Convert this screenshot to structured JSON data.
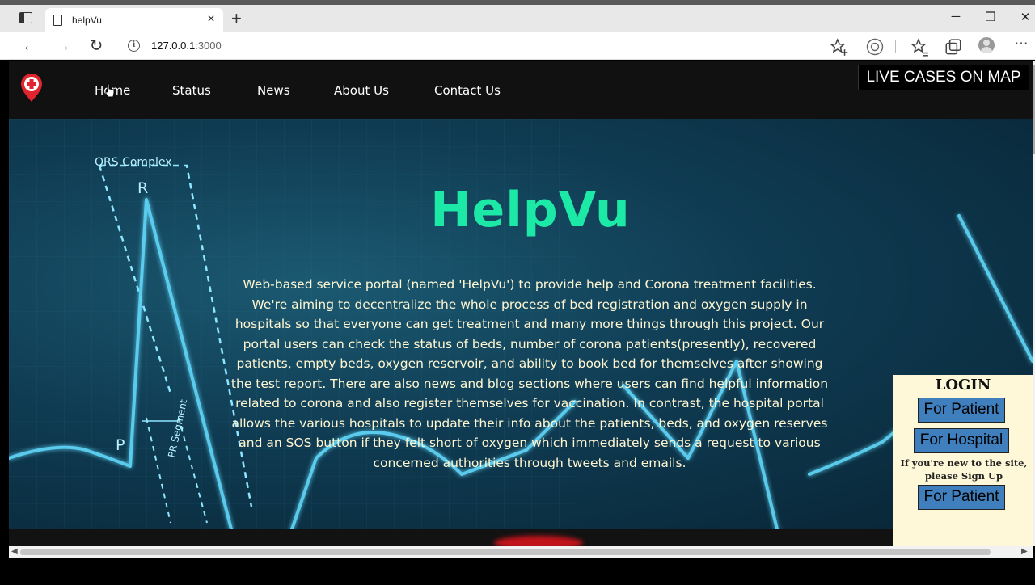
{
  "browser": {
    "tab_title": "helpVu",
    "url_host": "127.0.0.1",
    "url_port": ":3000",
    "new_tab_glyph": "+",
    "close_tab_glyph": "×",
    "minimize_glyph": "─",
    "restore_glyph": "❐",
    "close_window_glyph": "✕",
    "back_glyph": "←",
    "forward_glyph": "→",
    "reload_glyph": "↻",
    "more_glyph": "⋯"
  },
  "site": {
    "nav": [
      {
        "label": "Home"
      },
      {
        "label": "Status"
      },
      {
        "label": "News"
      },
      {
        "label": "About Us"
      },
      {
        "label": "Contact Us"
      }
    ],
    "live_button": "LIVE CASES ON MAP",
    "hero_title": "HelpVu",
    "hero_description": "Web-based service portal (named 'HelpVu') to provide help and Corona treatment facilities. We're aiming to decentralize the whole process of bed registration and oxygen supply in hospitals so that everyone can get treatment and many more things through this project. Our portal users can check the status of beds, number of corona patients(presently), recovered patients, empty beds, oxygen reservoir, and ability to book bed for themselves after showing the test report. There are also news and blog sections where users can find helpful information related to corona and also register themselves for vaccination. In contrast, the hospital portal allows the various hospitals to update their info about the patients, beds, and oxygen reserves and an SOS button if they felt short of oxygen which immediately sends a request to various concerned authorities through tweets and emails.",
    "ecg_labels": {
      "qrs": "QRS Complex",
      "r": "R",
      "p": "P",
      "pr": "PR Segment"
    }
  },
  "login": {
    "title": "LOGIN",
    "patient_button": "For Patient",
    "hospital_button": "For Hospital",
    "signup_note": "If you're new to the site, please Sign Up",
    "signup_patient_button": "For Patient"
  },
  "colors": {
    "accent": "#1de9a6",
    "login_button": "#3f7fbd",
    "panel": "#fff8d8"
  }
}
